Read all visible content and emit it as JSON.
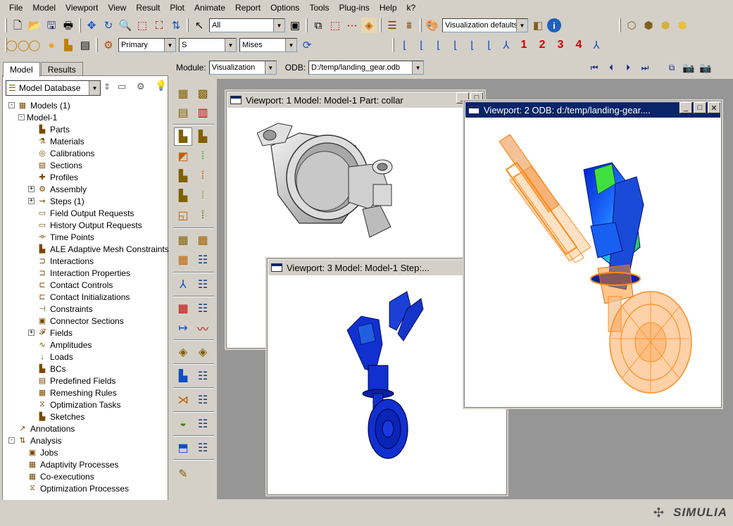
{
  "menu": [
    "File",
    "Model",
    "Viewport",
    "View",
    "Result",
    "Plot",
    "Animate",
    "Report",
    "Options",
    "Tools",
    "Plug-ins",
    "Help",
    "k?"
  ],
  "toolbar1": {
    "selection_filter": "All",
    "viz_defaults": "Visualization defaults"
  },
  "toolbar2": {
    "field_type": "Primary",
    "variable": "S",
    "invariant": "Mises",
    "numbers": [
      "1",
      "2",
      "3",
      "4"
    ]
  },
  "tabs": {
    "model": "Model",
    "results": "Results"
  },
  "model_database": "Model Database",
  "tree": [
    {
      "label": "Models (1)",
      "level": 0,
      "exp": "-",
      "icon": "models-icon"
    },
    {
      "label": "Model-1",
      "level": 1,
      "exp": "-",
      "icon": ""
    },
    {
      "label": "Parts",
      "level": 2,
      "exp": "",
      "icon": "parts-icon"
    },
    {
      "label": "Materials",
      "level": 2,
      "exp": "",
      "icon": "materials-icon"
    },
    {
      "label": "Calibrations",
      "level": 2,
      "exp": "",
      "icon": "calibrations-icon"
    },
    {
      "label": "Sections",
      "level": 2,
      "exp": "",
      "icon": "sections-icon"
    },
    {
      "label": "Profiles",
      "level": 2,
      "exp": "",
      "icon": "profiles-icon"
    },
    {
      "label": "Assembly",
      "level": 2,
      "exp": "+",
      "icon": "assembly-icon"
    },
    {
      "label": "Steps (1)",
      "level": 2,
      "exp": "+",
      "icon": "steps-icon"
    },
    {
      "label": "Field Output Requests",
      "level": 2,
      "exp": "",
      "icon": "field-output-icon"
    },
    {
      "label": "History Output Requests",
      "level": 2,
      "exp": "",
      "icon": "history-output-icon"
    },
    {
      "label": "Time Points",
      "level": 2,
      "exp": "",
      "icon": "time-points-icon"
    },
    {
      "label": "ALE Adaptive Mesh Constraints",
      "level": 2,
      "exp": "",
      "icon": "ale-icon"
    },
    {
      "label": "Interactions",
      "level": 2,
      "exp": "",
      "icon": "interactions-icon"
    },
    {
      "label": "Interaction Properties",
      "level": 2,
      "exp": "",
      "icon": "interaction-properties-icon"
    },
    {
      "label": "Contact Controls",
      "level": 2,
      "exp": "",
      "icon": "contact-controls-icon"
    },
    {
      "label": "Contact Initializations",
      "level": 2,
      "exp": "",
      "icon": "contact-init-icon"
    },
    {
      "label": "Constraints",
      "level": 2,
      "exp": "",
      "icon": "constraints-icon"
    },
    {
      "label": "Connector Sections",
      "level": 2,
      "exp": "",
      "icon": "connector-sections-icon"
    },
    {
      "label": "Fields",
      "level": 2,
      "exp": "+",
      "icon": "fields-icon"
    },
    {
      "label": "Amplitudes",
      "level": 2,
      "exp": "",
      "icon": "amplitudes-icon"
    },
    {
      "label": "Loads",
      "level": 2,
      "exp": "",
      "icon": "loads-icon"
    },
    {
      "label": "BCs",
      "level": 2,
      "exp": "",
      "icon": "bcs-icon"
    },
    {
      "label": "Predefined Fields",
      "level": 2,
      "exp": "",
      "icon": "predefined-fields-icon"
    },
    {
      "label": "Remeshing Rules",
      "level": 2,
      "exp": "",
      "icon": "remeshing-icon"
    },
    {
      "label": "Optimization Tasks",
      "level": 2,
      "exp": "",
      "icon": "optimization-tasks-icon"
    },
    {
      "label": "Sketches",
      "level": 2,
      "exp": "",
      "icon": "sketches-icon"
    },
    {
      "label": "Annotations",
      "level": 0,
      "exp": "",
      "icon": "annotations-icon"
    },
    {
      "label": "Analysis",
      "level": 0,
      "exp": "-",
      "icon": "analysis-icon"
    },
    {
      "label": "Jobs",
      "level": 1,
      "exp": "",
      "icon": "jobs-icon"
    },
    {
      "label": "Adaptivity Processes",
      "level": 1,
      "exp": "",
      "icon": "adaptivity-icon"
    },
    {
      "label": "Co-executions",
      "level": 1,
      "exp": "",
      "icon": "co-executions-icon"
    },
    {
      "label": "Optimization Processes",
      "level": 1,
      "exp": "",
      "icon": "optimization-processes-icon"
    }
  ],
  "module_bar": {
    "module_label": "Module:",
    "module_value": "Visualization",
    "odb_label": "ODB:",
    "odb_value": "D:/temp/landing_gear.odb"
  },
  "viewports": [
    {
      "title": "Viewport: 1     Model: Model-1     Part: collar",
      "active": false
    },
    {
      "title": "Viewport: 2     ODB: d:/temp/landing-gear....",
      "active": true
    },
    {
      "title": "Viewport: 3     Model: Model-1     Step:...",
      "active": false
    }
  ],
  "brand": "SIMULIA",
  "colors": {
    "active_title": "#0a246a",
    "background": "#969696",
    "number_buttons": "#d00000",
    "stress_blue": "#1030d0",
    "orange_mesh": "#ff8c1a"
  }
}
